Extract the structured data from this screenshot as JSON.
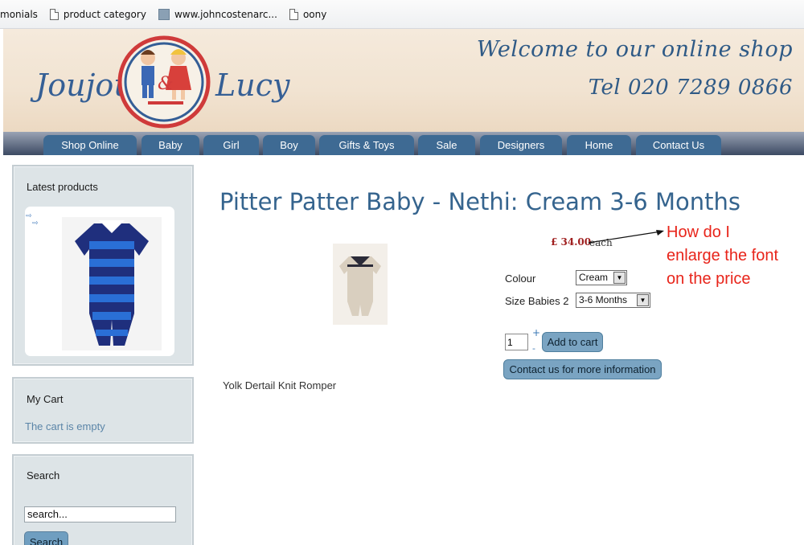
{
  "bookmarks": [
    {
      "label": "monials",
      "icon": "none"
    },
    {
      "label": "product category",
      "icon": "page-icon"
    },
    {
      "label": "www.johncostenarc...",
      "icon": "favicon"
    },
    {
      "label": "oony",
      "icon": "page-icon"
    }
  ],
  "header": {
    "logo_left": "Joujou",
    "logo_amp": "&",
    "logo_right": "Lucy",
    "welcome": "Welcome to our online shop",
    "phone": "Tel 020 7289 0866"
  },
  "nav": [
    "Shop Online",
    "Baby",
    "Girl",
    "Boy",
    "Gifts & Toys",
    "Sale",
    "Designers",
    "Home",
    "Contact Us"
  ],
  "sidebar": {
    "latest_title": "Latest products",
    "cart_title": "My Cart",
    "cart_empty": "The cart is empty",
    "search_title": "Search",
    "search_value": "search...",
    "search_button": "Search"
  },
  "product": {
    "title": "Pitter Patter Baby - Nethi: Cream 3-6 Months",
    "price": "£ 34.00",
    "price_unit": "each",
    "colour_label": "Colour",
    "colour_value": "Cream",
    "size_label": "Size Babies 2",
    "size_value": "3-6 Months",
    "quantity": "1",
    "add_to_cart": "Add to cart",
    "contact_button": "Contact us for more information",
    "description": "Yolk Dertail Knit Romper"
  },
  "annotation": {
    "lines": [
      "How do I",
      "enlarge the font",
      "on the price"
    ],
    "color": "#e8241a"
  },
  "colors": {
    "nav_tab": "#3e6a93",
    "title": "#35648e",
    "price": "#a02020",
    "sidebar_bg": "#dde4e7"
  }
}
